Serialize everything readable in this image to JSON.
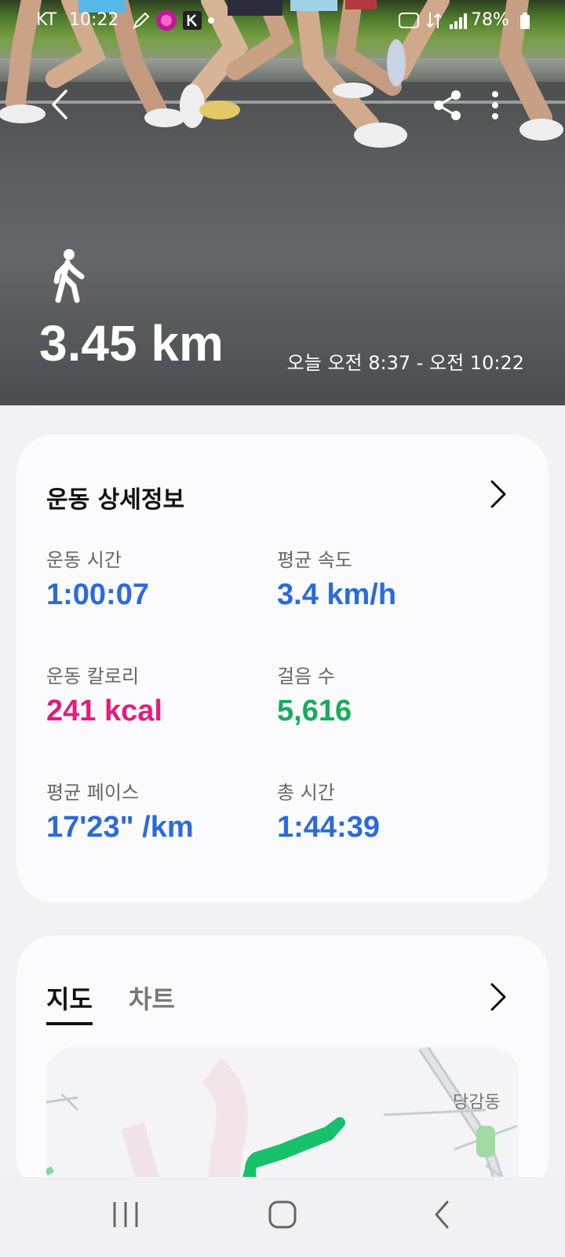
{
  "status_bar": {
    "carrier": "KT",
    "time": "10:22",
    "battery": "78%"
  },
  "hero": {
    "distance": "3.45 km",
    "time_range": "오늘 오전 8:37 - 오전 10:22"
  },
  "detail_card": {
    "title": "운동 상세정보",
    "stats": [
      {
        "label": "운동 시간",
        "value": "1:00:07",
        "color": "#2a6bdc"
      },
      {
        "label": "평균 속도",
        "value": "3.4 km/h",
        "color": "#2a6bdc"
      },
      {
        "label": "운동 칼로리",
        "value": "241 kcal",
        "color": "#e01e7e"
      },
      {
        "label": "걸음 수",
        "value": "5,616",
        "color": "#17ad5b"
      },
      {
        "label": "평균 페이스",
        "value": "17'23\" /km",
        "color": "#2a6bdc"
      },
      {
        "label": "총 시간",
        "value": "1:44:39",
        "color": "#2a6bdc"
      }
    ]
  },
  "map_card": {
    "tabs": [
      "지도",
      "차트"
    ],
    "active_tab": "지도",
    "map_place_label": "당감동",
    "route_color": "#17c06a"
  },
  "icons": {
    "back": "chevron-left-icon",
    "share": "share-icon",
    "more": "more-vertical-icon",
    "activity": "walking-icon",
    "nav_recents": "recents-icon",
    "nav_home": "home-icon",
    "nav_back": "back-icon"
  }
}
